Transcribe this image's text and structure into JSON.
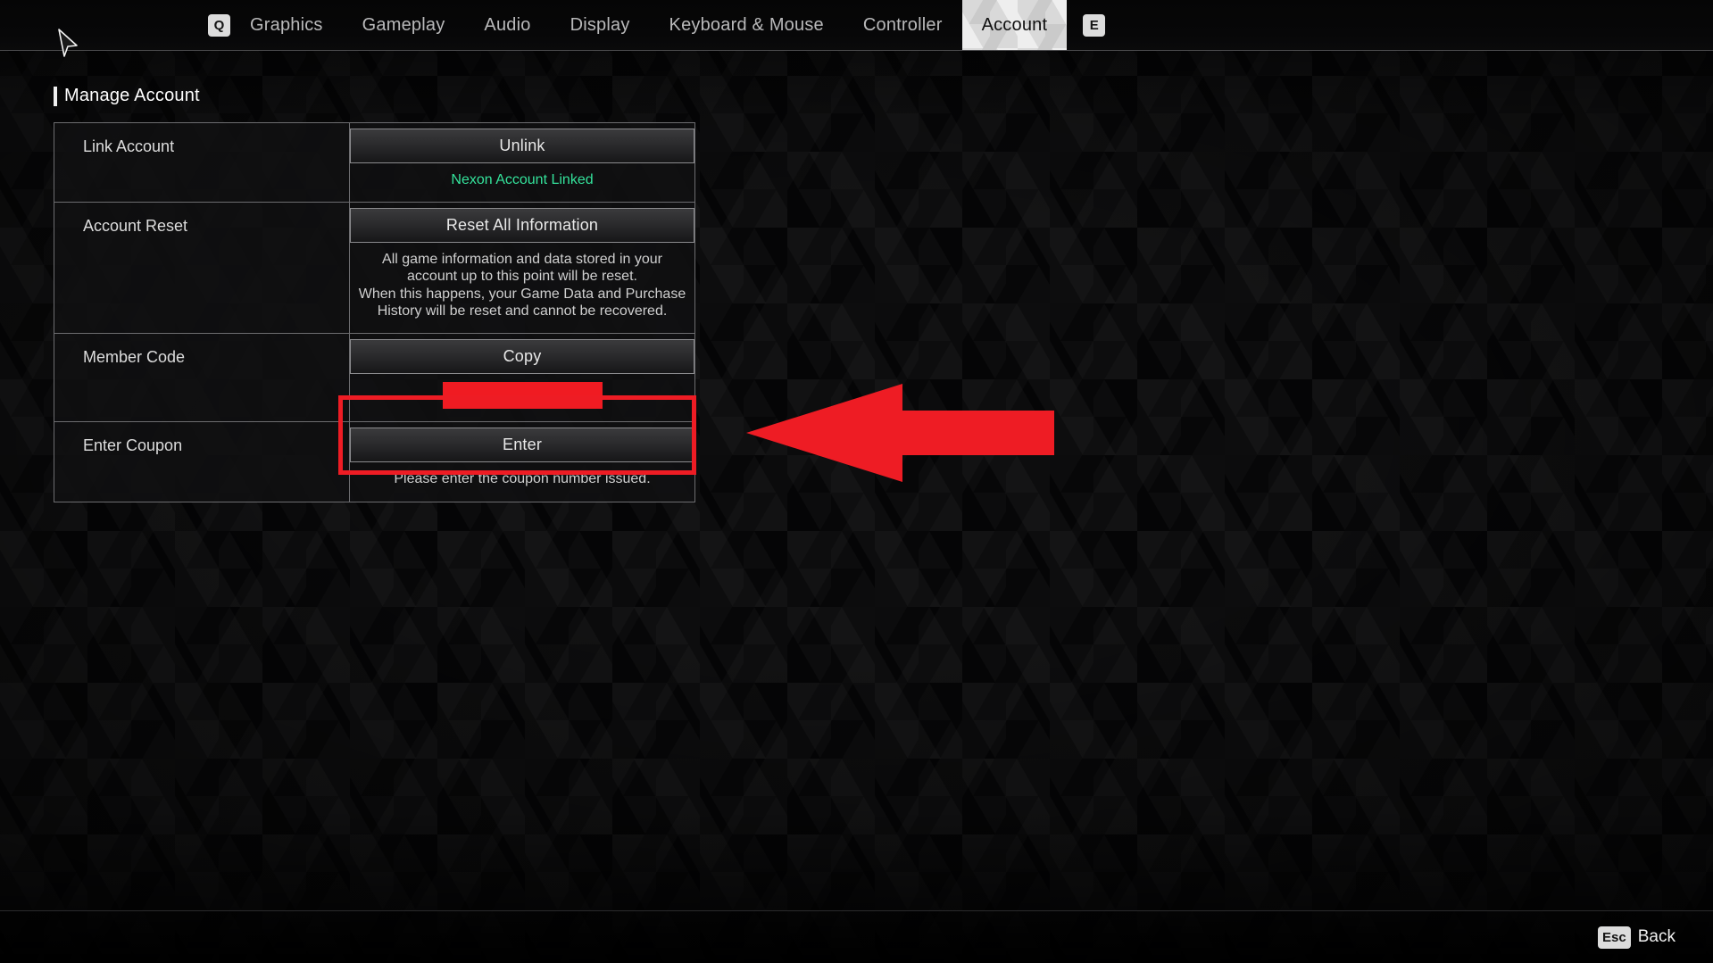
{
  "nav": {
    "left_key": "Q",
    "right_key": "E",
    "tabs": [
      {
        "label": "Graphics",
        "active": false
      },
      {
        "label": "Gameplay",
        "active": false
      },
      {
        "label": "Audio",
        "active": false
      },
      {
        "label": "Display",
        "active": false
      },
      {
        "label": "Keyboard & Mouse",
        "active": false
      },
      {
        "label": "Controller",
        "active": false
      },
      {
        "label": "Account",
        "active": true
      }
    ]
  },
  "section": {
    "title": "Manage Account"
  },
  "rows": {
    "link_account": {
      "label": "Link Account",
      "button": "Unlink",
      "status": "Nexon Account Linked",
      "status_color": "#34e29b"
    },
    "account_reset": {
      "label": "Account Reset",
      "button": "Reset All Information",
      "description_line1": "All game information and data stored in your",
      "description_line2": "account up to this point will be reset.",
      "description_line3": "When this happens, your Game Data and Purchase",
      "description_line4": "History will be reset and cannot be recovered."
    },
    "member_code": {
      "label": "Member Code",
      "button": "Copy",
      "value_redacted": ""
    },
    "enter_coupon": {
      "label": "Enter Coupon",
      "button": "Enter",
      "hint": "Please enter the coupon number issued."
    }
  },
  "annotations": {
    "highlight_color": "#ee1c24",
    "arrow_color": "#ee1c24",
    "redaction_color": "#f01b22"
  },
  "bottom": {
    "back_key": "Esc",
    "back_label": "Back"
  }
}
